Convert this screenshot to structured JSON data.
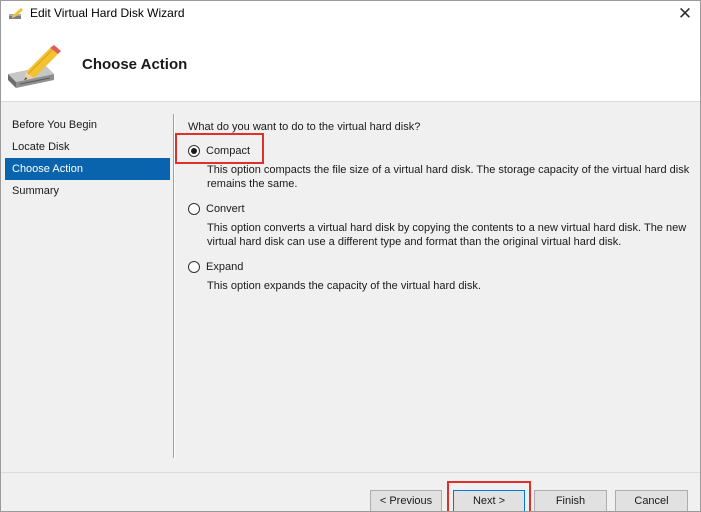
{
  "window": {
    "title": "Edit Virtual Hard Disk Wizard",
    "close_glyph": "✕"
  },
  "header": {
    "title": "Choose Action",
    "icon": "pencil-disk-icon"
  },
  "nav": {
    "items": [
      {
        "label": "Before You Begin",
        "active": false
      },
      {
        "label": "Locate Disk",
        "active": false
      },
      {
        "label": "Choose Action",
        "active": true
      },
      {
        "label": "Summary",
        "active": false
      }
    ]
  },
  "main": {
    "question": "What do you want to do to the virtual hard disk?",
    "options": [
      {
        "label": "Compact",
        "checked": true,
        "description": "This option compacts the file size of a virtual hard disk. The storage capacity of the virtual hard disk remains the same."
      },
      {
        "label": "Convert",
        "checked": false,
        "description": "This option converts a virtual hard disk by copying the contents to a new virtual hard disk. The new virtual hard disk can use a different type and format than the original virtual hard disk."
      },
      {
        "label": "Expand",
        "checked": false,
        "description": "This option expands the capacity of the virtual hard disk."
      }
    ]
  },
  "footer": {
    "previous_label": "< Previous",
    "next_label": "Next >",
    "finish_label": "Finish",
    "cancel_label": "Cancel"
  },
  "colors": {
    "nav_active": "#0a64ad",
    "annotation_red": "#e0302b",
    "default_button_border": "#0078d7"
  }
}
